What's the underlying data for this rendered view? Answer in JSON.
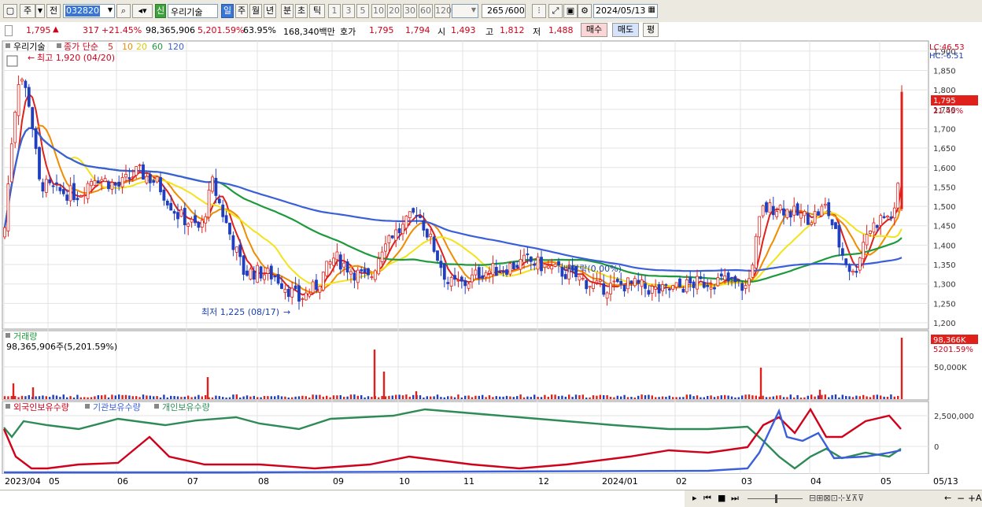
{
  "toolbar": {
    "period_label": "주",
    "type_label": "전",
    "code": "032820",
    "new_badge": "신",
    "stock_name": "우리기술",
    "periods": [
      "일",
      "주",
      "월",
      "년",
      "분",
      "초",
      "틱"
    ],
    "active_period": "일",
    "intervals": [
      "1",
      "3",
      "5",
      "10",
      "20",
      "30",
      "60",
      "120"
    ],
    "count": "265",
    "count_max": "/600",
    "date": "2024/05/13"
  },
  "pricebar": {
    "price": "1,795",
    "arrow": "▲",
    "change": "317",
    "change_pct": "+21.45%",
    "volume": "98,365,906",
    "volume_pct": "5,201.59%",
    "turnover": "63.95%",
    "amount": "168,340백만",
    "quote_label": "호가",
    "ask": "1,795",
    "bid": "1,794",
    "open_label": "시",
    "open": "1,493",
    "high_label": "고",
    "high": "1,812",
    "low_label": "저",
    "low": "1,488",
    "buy_button": "매수",
    "sell_button": "매도",
    "eval_button": "평"
  },
  "price_panel": {
    "name": "우리기술",
    "ma_label": "종가 단순",
    "ma_periods": [
      "5",
      "10",
      "20",
      "60",
      "120"
    ],
    "ma_colors": [
      "#e0201b",
      "#f08c00",
      "#f2e31a",
      "#1e9a3c",
      "#3a5fd8"
    ],
    "high_note": "최고 1,920 (04/20)",
    "low_note": "최저 1,225 (08/17)",
    "dividend_note": "배당락(0.00%)",
    "lc": "LC:46.53",
    "hc": "HC:-6.51",
    "last_price": "1,795",
    "last_pct": "21.45%",
    "y_ticks": [
      "1,900",
      "1,850",
      "1,800",
      "1,750",
      "1,700",
      "1,650",
      "1,600",
      "1,550",
      "1,500",
      "1,450",
      "1,400",
      "1,350",
      "1,300",
      "1,250",
      "1,200"
    ]
  },
  "volume_panel": {
    "title": "거래량",
    "value": "98,365,906주(5,201.59%)",
    "last_value": "98,366K",
    "last_pct": "5201.59%",
    "y_tick": "50,000K"
  },
  "holding_panel": {
    "legend": [
      "외국인보유수량",
      "기관보유수량",
      "개인보유수량"
    ],
    "legend_colors": [
      "#d0021b",
      "#3a5fd8",
      "#2e8b57"
    ],
    "y_ticks": [
      "2,500,000",
      "0"
    ]
  },
  "x_axis": [
    "2023/04",
    "05",
    "06",
    "07",
    "08",
    "09",
    "10",
    "11",
    "12",
    "2024/01",
    "02",
    "03",
    "04",
    "05"
  ],
  "x_end": "05/13",
  "chart_data": {
    "type": "candlestick",
    "price_range": [
      1200,
      1920
    ],
    "ma_periods": [
      5,
      10,
      20,
      60,
      120
    ],
    "high": {
      "value": 1920,
      "date": "04/20"
    },
    "low": {
      "value": 1225,
      "date": "08/17"
    },
    "last": {
      "close": 1795,
      "open": 1493,
      "high": 1812,
      "low": 1488,
      "change_pct": 21.45
    },
    "volume_last": 98365906
  }
}
